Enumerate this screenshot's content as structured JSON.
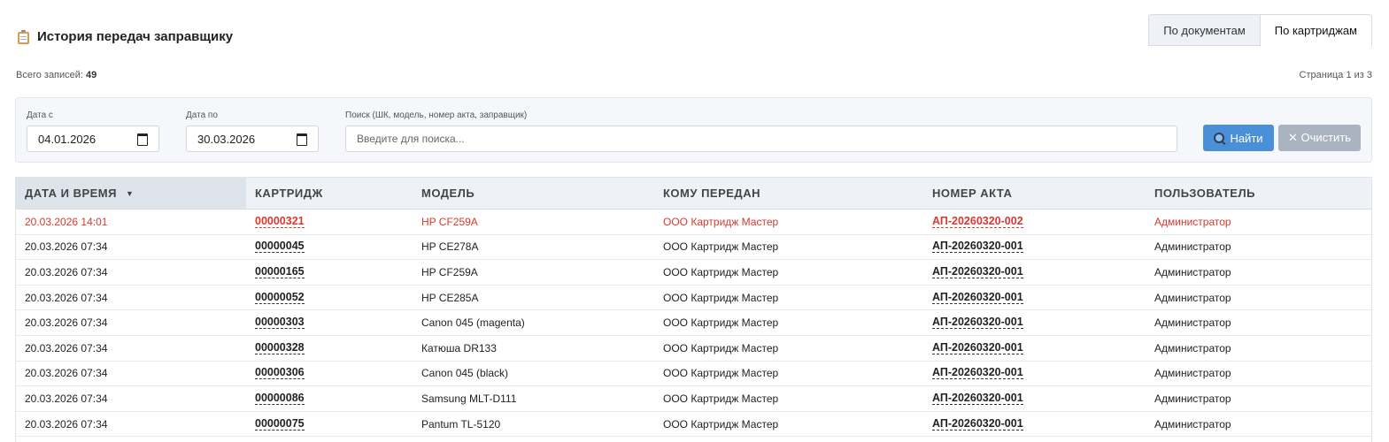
{
  "page": {
    "title": "История передач заправщику",
    "tabs": [
      {
        "label": "По документам",
        "active": false
      },
      {
        "label": "По картриджам",
        "active": true
      }
    ],
    "count_label": "Всего записей:",
    "count_value": "49",
    "page_info": "Страница 1 из 3"
  },
  "filter": {
    "date_from_label": "Дата с",
    "date_from_value": "04.01.2026",
    "date_to_label": "Дата по",
    "date_to_value": "30.03.2026",
    "search_label": "Поиск (ШК, модель, номер акта, заправщик)",
    "search_placeholder": "Введите для поиска...",
    "find_label": "Найти",
    "clear_label": "✕ Очистить"
  },
  "table": {
    "columns": [
      "ДАТА И ВРЕМЯ",
      "КАРТРИДЖ",
      "МОДЕЛЬ",
      "КОМУ ПЕРЕДАН",
      "НОМЕР АКТА",
      "ПОЛЬЗОВАТЕЛЬ"
    ],
    "sort_arrow": "▼",
    "rows": [
      {
        "datetime": "20.03.2026 14:01",
        "cartridge": "00000321",
        "model": "HP CF259A",
        "recipient": "ООО Картридж Мастер",
        "act": "АП-20260320-002",
        "user": "Администратор",
        "highlight": true
      },
      {
        "datetime": "20.03.2026 07:34",
        "cartridge": "00000045",
        "model": "HP CE278A",
        "recipient": "ООО Картридж Мастер",
        "act": "АП-20260320-001",
        "user": "Администратор",
        "highlight": false
      },
      {
        "datetime": "20.03.2026 07:34",
        "cartridge": "00000165",
        "model": "HP CF259A",
        "recipient": "ООО Картридж Мастер",
        "act": "АП-20260320-001",
        "user": "Администратор",
        "highlight": false
      },
      {
        "datetime": "20.03.2026 07:34",
        "cartridge": "00000052",
        "model": "HP CE285A",
        "recipient": "ООО Картридж Мастер",
        "act": "АП-20260320-001",
        "user": "Администратор",
        "highlight": false
      },
      {
        "datetime": "20.03.2026 07:34",
        "cartridge": "00000303",
        "model": "Canon 045 (magenta)",
        "recipient": "ООО Картридж Мастер",
        "act": "АП-20260320-001",
        "user": "Администратор",
        "highlight": false
      },
      {
        "datetime": "20.03.2026 07:34",
        "cartridge": "00000328",
        "model": "Катюша DR133",
        "recipient": "ООО Картридж Мастер",
        "act": "АП-20260320-001",
        "user": "Администратор",
        "highlight": false
      },
      {
        "datetime": "20.03.2026 07:34",
        "cartridge": "00000306",
        "model": "Canon 045 (black)",
        "recipient": "ООО Картридж Мастер",
        "act": "АП-20260320-001",
        "user": "Администратор",
        "highlight": false
      },
      {
        "datetime": "20.03.2026 07:34",
        "cartridge": "00000086",
        "model": "Samsung MLT-D111",
        "recipient": "ООО Картридж Мастер",
        "act": "АП-20260320-001",
        "user": "Администратор",
        "highlight": false
      },
      {
        "datetime": "20.03.2026 07:34",
        "cartridge": "00000075",
        "model": "Pantum TL-5120",
        "recipient": "ООО Картридж Мастер",
        "act": "АП-20260320-001",
        "user": "Администратор",
        "highlight": false
      }
    ]
  },
  "icons": {
    "title_icon": "clipboard-icon",
    "find_icon": "magnifier-icon",
    "calendar_icon": "calendar-icon"
  },
  "colors": {
    "accent": "#4a90d9",
    "highlight_text": "#d9392f",
    "clear_button": "#a9b4c0"
  }
}
